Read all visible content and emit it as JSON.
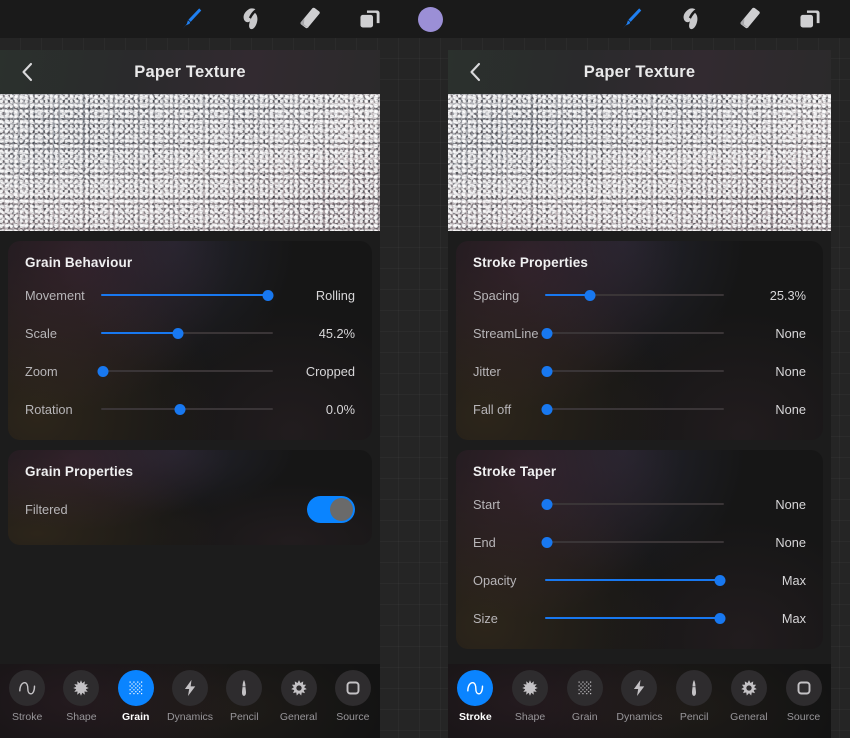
{
  "toolbar": {
    "left_tools": [
      {
        "name": "brush-tool",
        "icon": "paintbrush-icon",
        "active": true
      },
      {
        "name": "smudge-tool",
        "icon": "smudge-icon",
        "active": false
      },
      {
        "name": "eraser-tool",
        "icon": "eraser-icon",
        "active": false
      },
      {
        "name": "layers-tool",
        "icon": "layers-icon",
        "active": false
      },
      {
        "name": "color-swatch",
        "icon": "color-circle-icon",
        "active": false
      }
    ],
    "right_tools": [
      {
        "name": "brush-tool",
        "icon": "paintbrush-icon",
        "active": true
      },
      {
        "name": "smudge-tool",
        "icon": "smudge-icon",
        "active": false
      },
      {
        "name": "eraser-tool",
        "icon": "eraser-icon",
        "active": false
      },
      {
        "name": "layers-tool",
        "icon": "layers-icon",
        "active": false
      }
    ],
    "color_swatch_hex": "#9b8fd6",
    "accent_hex": "#0a84ff"
  },
  "left_panel": {
    "title": "Paper Texture",
    "back_icon": "chevron-left-icon",
    "texture_name": "paper-texture-preview",
    "sections": [
      {
        "title": "Grain Behaviour",
        "rows": [
          {
            "label": "Movement",
            "value": "Rolling",
            "percent": 97,
            "filled": true
          },
          {
            "label": "Scale",
            "value": "45.2%",
            "percent": 45,
            "filled": true
          },
          {
            "label": "Zoom",
            "value": "Cropped",
            "percent": 1,
            "filled": false
          },
          {
            "label": "Rotation",
            "value": "0.0%",
            "percent": 46,
            "filled": false
          }
        ]
      },
      {
        "title": "Grain Properties",
        "toggles": [
          {
            "label": "Filtered",
            "on": true
          }
        ]
      }
    ],
    "tabs": [
      {
        "label": "Stroke",
        "icon": "wave-icon",
        "active": false
      },
      {
        "label": "Shape",
        "icon": "starburst-icon",
        "active": false
      },
      {
        "label": "Grain",
        "icon": "grain-dots-icon",
        "active": true
      },
      {
        "label": "Dynamics",
        "icon": "lightning-icon",
        "active": false
      },
      {
        "label": "Pencil",
        "icon": "pencil-nib-icon",
        "active": false
      },
      {
        "label": "General",
        "icon": "gear-icon",
        "active": false
      },
      {
        "label": "Source",
        "icon": "source-square-icon",
        "active": false
      }
    ]
  },
  "right_panel": {
    "title": "Paper Texture",
    "back_icon": "chevron-left-icon",
    "texture_name": "paper-texture-preview",
    "sections": [
      {
        "title": "Stroke Properties",
        "rows": [
          {
            "label": "Spacing",
            "value": "25.3%",
            "percent": 25,
            "filled": true
          },
          {
            "label": "StreamLine",
            "value": "None",
            "percent": 1,
            "filled": false
          },
          {
            "label": "Jitter",
            "value": "None",
            "percent": 1,
            "filled": false
          },
          {
            "label": "Fall off",
            "value": "None",
            "percent": 1,
            "filled": false
          }
        ]
      },
      {
        "title": "Stroke Taper",
        "rows": [
          {
            "label": "Start",
            "value": "None",
            "percent": 1,
            "filled": false
          },
          {
            "label": "End",
            "value": "None",
            "percent": 1,
            "filled": false
          },
          {
            "label": "Opacity",
            "value": "Max",
            "percent": 98,
            "filled": true
          },
          {
            "label": "Size",
            "value": "Max",
            "percent": 98,
            "filled": true
          }
        ]
      }
    ],
    "tabs": [
      {
        "label": "Stroke",
        "icon": "wave-icon",
        "active": true
      },
      {
        "label": "Shape",
        "icon": "starburst-icon",
        "active": false
      },
      {
        "label": "Grain",
        "icon": "grain-dots-icon",
        "active": false
      },
      {
        "label": "Dynamics",
        "icon": "lightning-icon",
        "active": false
      },
      {
        "label": "Pencil",
        "icon": "pencil-nib-icon",
        "active": false
      },
      {
        "label": "General",
        "icon": "gear-icon",
        "active": false
      },
      {
        "label": "Source",
        "icon": "source-square-icon",
        "active": false
      }
    ]
  }
}
